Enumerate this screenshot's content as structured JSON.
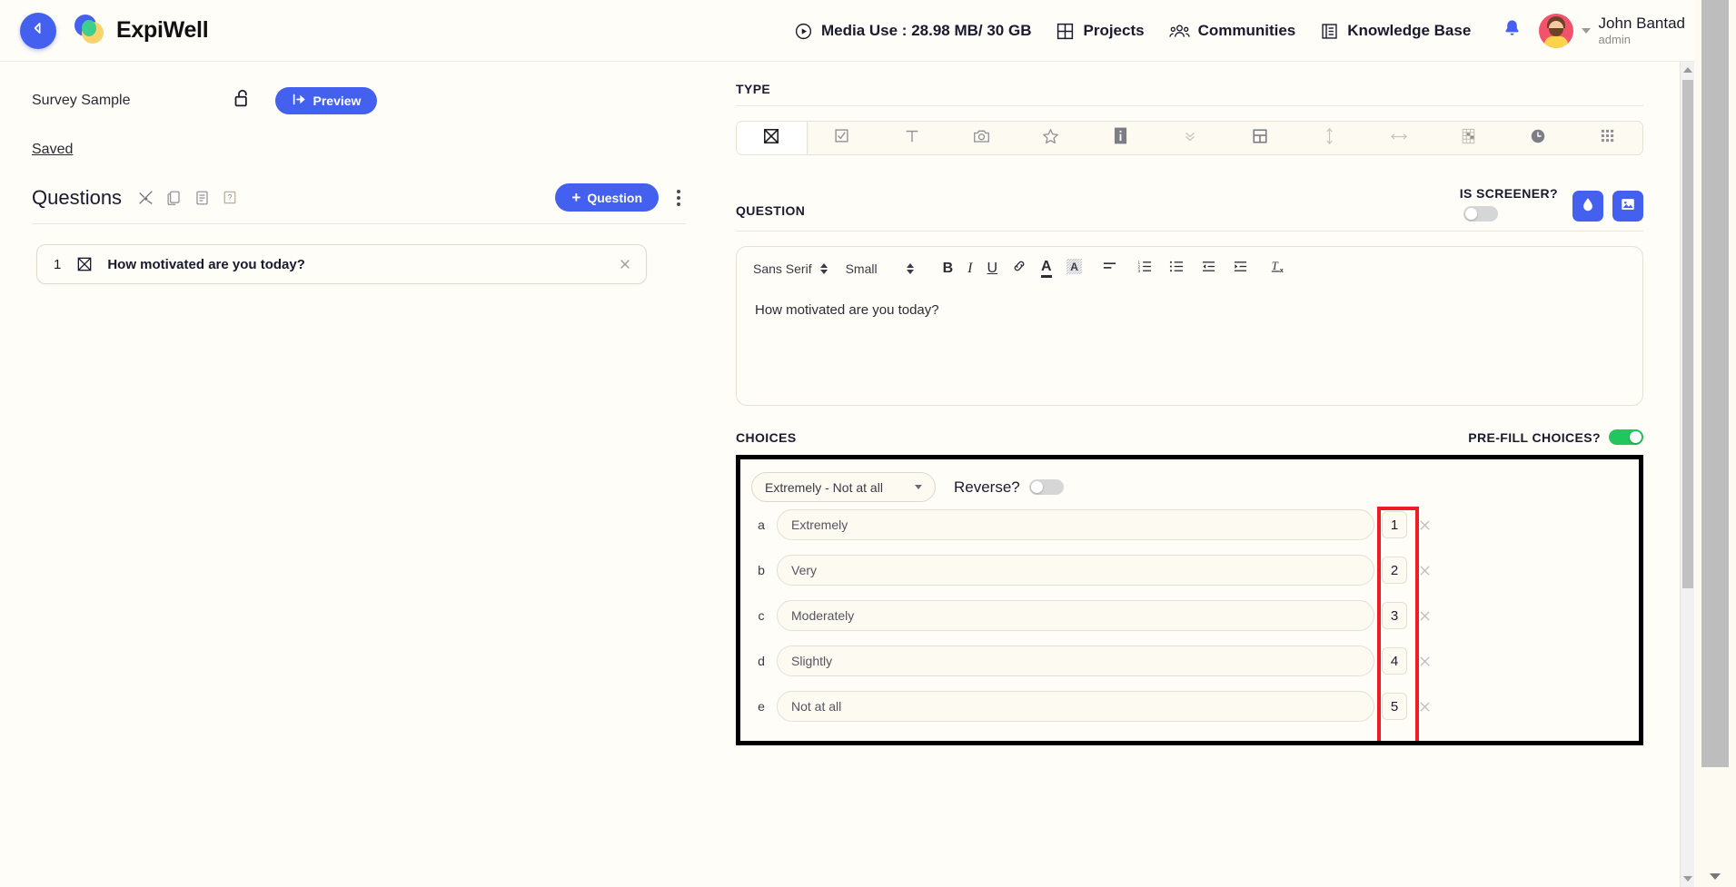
{
  "header": {
    "back_icon": "back-arrow-icon",
    "brand": "ExpiWell",
    "nav": [
      {
        "icon": "media-play-circle-icon",
        "label": "Media Use : 28.98 MB/ 30 GB"
      },
      {
        "icon": "projects-grid-icon",
        "label": "Projects"
      },
      {
        "icon": "communities-people-icon",
        "label": "Communities"
      },
      {
        "icon": "knowledge-base-book-icon",
        "label": "Knowledge Base"
      }
    ],
    "bell_icon": "notification-bell-icon",
    "user_name": "John Bantad",
    "user_role": "admin"
  },
  "left": {
    "survey_title": "Survey Sample",
    "lock_icon": "unlock-icon",
    "preview_label": "Preview",
    "preview_icon": "preview-export-icon",
    "saved_label": "Saved",
    "questions_label": "Questions",
    "question_tools": [
      {
        "icon": "shuffle-icon",
        "name": "shuffle-questions"
      },
      {
        "icon": "copy-icon",
        "name": "duplicate-questions"
      },
      {
        "icon": "list-icon",
        "name": "question-list"
      },
      {
        "icon": "help-icon",
        "name": "question-help"
      }
    ],
    "add_question_label": "Question",
    "add_question_plus": "+",
    "kebab_icon": "more-options-icon",
    "question_items": [
      {
        "number": "1",
        "type_icon": "multiple-choice-icon",
        "text": "How motivated are you today?"
      }
    ]
  },
  "right": {
    "type_section_label": "TYPE",
    "type_options": [
      {
        "name": "multiple-choice",
        "icon": "boxed-x-icon",
        "active": true
      },
      {
        "name": "checkbox",
        "icon": "checkbox-icon",
        "active": false
      },
      {
        "name": "text",
        "icon": "text-t-icon",
        "active": false
      },
      {
        "name": "photo",
        "icon": "camera-icon",
        "active": false
      },
      {
        "name": "rating",
        "icon": "star-icon",
        "active": false
      },
      {
        "name": "info",
        "icon": "info-block-icon",
        "active": false
      },
      {
        "name": "dropdown",
        "icon": "double-chevron-down-icon",
        "active": false
      },
      {
        "name": "layout",
        "icon": "layout-split-icon",
        "active": false
      },
      {
        "name": "vertical-slider",
        "icon": "vertical-arrow-icon",
        "active": false
      },
      {
        "name": "horizontal-slider",
        "icon": "horizontal-arrow-icon",
        "active": false
      },
      {
        "name": "matrix",
        "icon": "matrix-table-icon",
        "active": false
      },
      {
        "name": "time",
        "icon": "clock-icon",
        "active": false
      },
      {
        "name": "grid",
        "icon": "dots-grid-icon",
        "active": false
      }
    ],
    "question_section_label": "QUESTION",
    "is_screener_label": "IS SCREENER?",
    "is_screener_on": false,
    "ink_button_icon": "ink-drop-icon",
    "image_button_icon": "image-icon",
    "editor": {
      "font_family": "Sans Serif",
      "font_size": "Small",
      "tools": [
        {
          "name": "bold",
          "glyph": "B"
        },
        {
          "name": "italic",
          "glyph": "I"
        },
        {
          "name": "underline",
          "glyph": "U"
        },
        {
          "name": "link",
          "glyph": "link-icon"
        },
        {
          "name": "text-color",
          "glyph": "A"
        },
        {
          "name": "highlight-color",
          "glyph": "A-highlight"
        },
        {
          "name": "align",
          "glyph": "align-icon"
        },
        {
          "name": "ordered-list",
          "glyph": "ordered-list-icon"
        },
        {
          "name": "bullet-list",
          "glyph": "bullet-list-icon"
        },
        {
          "name": "outdent",
          "glyph": "outdent-icon"
        },
        {
          "name": "indent",
          "glyph": "indent-icon"
        },
        {
          "name": "clear-format",
          "glyph": "clear-format-icon"
        }
      ],
      "body_text": "How motivated are you today?"
    },
    "choices_section_label": "CHOICES",
    "prefill_label": "PRE-FILL CHOICES?",
    "prefill_on": true,
    "prefill_color": "#22c55e",
    "scale_preset": "Extremely - Not at all",
    "reverse_label": "Reverse?",
    "reverse_on": false,
    "choices": [
      {
        "letter": "a",
        "text": "Extremely",
        "value": "1"
      },
      {
        "letter": "b",
        "text": "Very",
        "value": "2"
      },
      {
        "letter": "c",
        "text": "Moderately",
        "value": "3"
      },
      {
        "letter": "d",
        "text": "Slightly",
        "value": "4"
      },
      {
        "letter": "e",
        "text": "Not at all",
        "value": "5"
      }
    ],
    "remove_choice_icon": "close-x-icon",
    "highlight_color": "#ee1c25"
  }
}
